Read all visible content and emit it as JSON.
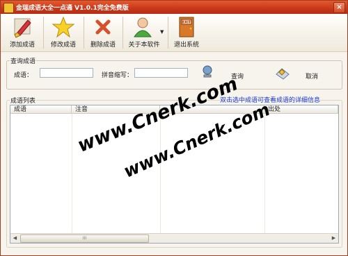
{
  "window": {
    "title": "金瑞成语大全一点通 V1.0.1完全免费版",
    "close_glyph": "×"
  },
  "toolbar": {
    "buttons": [
      {
        "label": "添加成语",
        "icon": "brush-add-icon"
      },
      {
        "label": "修改成语",
        "icon": "star-edit-icon"
      },
      {
        "label": "删除成语",
        "icon": "delete-x-icon"
      },
      {
        "label": "关于本软件",
        "icon": "user-info-icon"
      },
      {
        "label": "退出系统",
        "icon": "exit-door-icon"
      }
    ],
    "about_dropdown_glyph": "▼"
  },
  "query_panel": {
    "title": "查询成语",
    "idiom_label": "成语：",
    "idiom_value": "",
    "pinyin_label": "拼音缩写：",
    "pinyin_value": "",
    "search_label": "查询",
    "cancel_label": "取消"
  },
  "list_panel": {
    "title": "成语列表",
    "hint": "双击选中成语可查看成语的详细信息",
    "columns": [
      "成语",
      "注音",
      "",
      "出处"
    ],
    "rows": [],
    "scroll_thumb_grip": "III"
  },
  "watermarks": [
    "www.Cnerk.com",
    "www.Cnerk.com"
  ]
}
